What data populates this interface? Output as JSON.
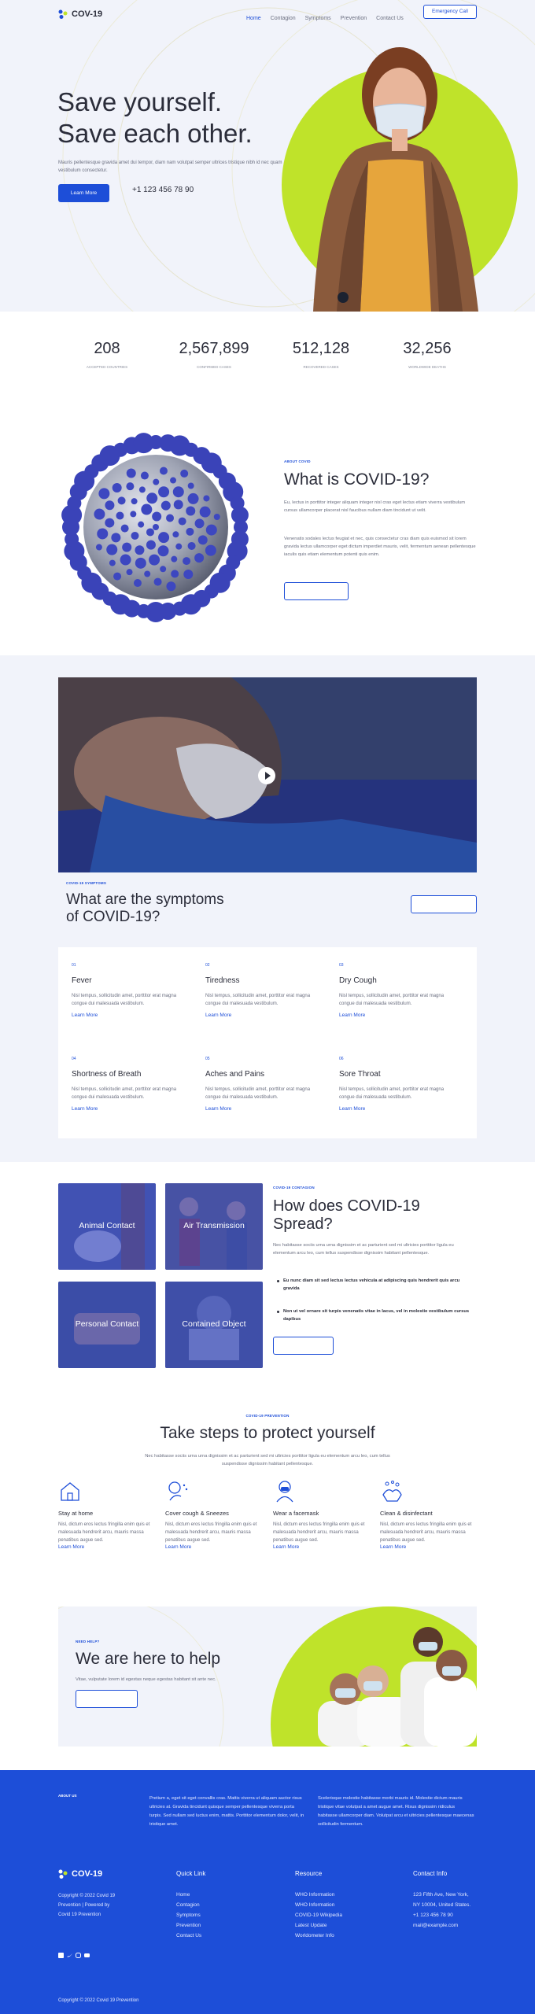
{
  "header": {
    "brand": "COV-19",
    "nav": [
      "Home",
      "Contagion",
      "Symptoms",
      "Prevention",
      "Contact Us"
    ],
    "cta": "Emergency Call"
  },
  "hero": {
    "title_line1": "Save yourself.",
    "title_line2": "Save each other.",
    "text": "Mauris pellentesque gravida amet dui tempor, diam nam volutpat semper ultrices tristique nibh id nec quam vestibulum consectetur.",
    "button": "Learn More",
    "phone": "+1 123 456 78 90"
  },
  "stats": [
    {
      "value": "208",
      "label": "Accepted Countries"
    },
    {
      "value": "2,567,899",
      "label": "Confirmed Cases"
    },
    {
      "value": "512,128",
      "label": "Recovered Cases"
    },
    {
      "value": "32,256",
      "label": "Worldwide Deaths"
    }
  ],
  "about": {
    "eyebrow": "About COVID",
    "title": "What is COVID-19?",
    "p1": "Eu, lectus in porttitor integer aliquam integer nisl cras eget lectus etiam viverra vestibulum cursus ullamcorper placerat nisl faucibus nullam diam tincidunt ut velit.",
    "p2": "Venenatis sodales lectus feugiat et nec, quis consectetur cras diam quis euismod sit lorem gravida lectus ullamcorper eget dictum imperdiet mauris, velit, fermentum aenean pellentesque iaculis quis etiam elementum potenti quis enim."
  },
  "symptoms": {
    "eyebrow": "Covid-19 Symptoms",
    "title_line1": "What are the symptoms",
    "title_line2": "of COVID-19?",
    "items": [
      {
        "num": "01",
        "title": "Fever",
        "desc": "Nisl tempus, sollicitudin amet, porttitor erat magna congue dui malesuada vestibulum.",
        "link": "Learn More"
      },
      {
        "num": "02",
        "title": "Tiredness",
        "desc": "Nisl tempus, sollicitudin amet, porttitor erat magna congue dui malesuada vestibulum.",
        "link": "Learn More"
      },
      {
        "num": "03",
        "title": "Dry Cough",
        "desc": "Nisl tempus, sollicitudin amet, porttitor erat magna congue dui malesuada vestibulum.",
        "link": "Learn More"
      },
      {
        "num": "04",
        "title": "Shortness of Breath",
        "desc": "Nisl tempus, sollicitudin amet, porttitor erat magna congue dui malesuada vestibulum.",
        "link": "Learn More"
      },
      {
        "num": "05",
        "title": "Aches and Pains",
        "desc": "Nisl tempus, sollicitudin amet, porttitor erat magna congue dui malesuada vestibulum.",
        "link": "Learn More"
      },
      {
        "num": "06",
        "title": "Sore Throat",
        "desc": "Nisl tempus, sollicitudin amet, porttitor erat magna congue dui malesuada vestibulum.",
        "link": "Learn More"
      }
    ]
  },
  "contagion": {
    "tiles": [
      "Animal Contact",
      "Air Transmission",
      "Personal Contact",
      "Contained Object"
    ],
    "eyebrow": "Covid-19 Contagion",
    "title_line1": "How does COVID-19",
    "title_line2": "Spread?",
    "text": "Nec habitasse sociis urna urna dignissim et ac parturient sed mi ultricies porttitor ligula eu elementum arcu leo, cum tellus suspendisse dignissim habitant pellentesque.",
    "bullet1": "Eu nunc diam sit sed lectus lectus vehicula at adipiscing quis hendrerit quis arcu gravida",
    "bullet2": "Non ut vel ornare sit turpis venenatis vitae in lacus, vel in molestie vestibulum cursus dapibus"
  },
  "prevention": {
    "eyebrow": "Covid-19 Prevention",
    "title": "Take steps to protect yourself",
    "text": "Nec habitasse sociis urna urna dignissim et ac parturient sed mi ultricies porttitor ligula eu elementum arcu leo, cum tellus suspendisse dignissim habitant pellentesque.",
    "steps": [
      {
        "title": "Stay at home",
        "desc": "Nisl, dictum eros lectus fringilla enim quis et malesuada hendrerit arcu, mauris massa penatibus augue sed.",
        "link": "Learn More",
        "icon": "house-icon"
      },
      {
        "title": "Cover cough & Sneezes",
        "desc": "Nisl, dictum eros lectus fringilla enim quis et malesuada hendrerit arcu, mauris massa penatibus augue sed.",
        "link": "Learn More",
        "icon": "sneeze-icon"
      },
      {
        "title": "Wear a facemask",
        "desc": "Nisl, dictum eros lectus fringilla enim quis et malesuada hendrerit arcu, mauris massa penatibus augue sed.",
        "link": "Learn More",
        "icon": "mask-person-icon"
      },
      {
        "title": "Clean & disinfectant",
        "desc": "Nisl, dictum eros lectus fringilla enim quis et malesuada hendrerit arcu, mauris massa penatibus augue sed.",
        "link": "Learn More",
        "icon": "washing-hands-icon"
      }
    ]
  },
  "help": {
    "eyebrow": "Need Help?",
    "title": "We are here to help",
    "text": "Vitae, vulputate lorem id egestas neque egestas habitant sit ante nec."
  },
  "footer": {
    "about_label": "About Us",
    "about_p1": "Pretium a, eget sit eget convallis cras. Mattis viverra ut aliquam auctor risus ultricies at. Gravida tincidunt quisque semper pellentesque viverra porta turpis. Sed nullam sed luctus enim, mattis. Porttitor elementum dolor, velit, in tristique amet.",
    "about_p2": "Scelerisque molestie habitasse morbi mauris id. Molestie dictum mauris tristique vitae volutpat a amet augue amet. Risus dignissim ridiculus habitasse ullamcorper diam. Volutpat arcu et ultricies pellentesque maecenas sollicitudin fermentum.",
    "brand": "COV-19",
    "copy_small": "Copyright © 2022 Covid 19 Prevention | Powered by Covid 19 Prevention",
    "quick_title": "Quick Link",
    "quick": [
      "Home",
      "Contagion",
      "Symptoms",
      "Prevention",
      "Contact Us"
    ],
    "res_title": "Resource",
    "res": [
      "WHO Information",
      "WHO Information",
      "COVID-19 Wikipedia",
      "Latest Update",
      "Worldometer Info"
    ],
    "contact_title": "Contact Info",
    "contact": [
      "123 Fifth Ave, New York,",
      "NY 10004, United States.",
      "+1 123 456 78 90",
      "mail@example.com"
    ],
    "copyright": "Copyright © 2022 Covid 19 Prevention"
  },
  "colors": {
    "accent": "#1d4ed8",
    "lime": "#bfe32a",
    "hero_bg": "#f1f3fa"
  }
}
